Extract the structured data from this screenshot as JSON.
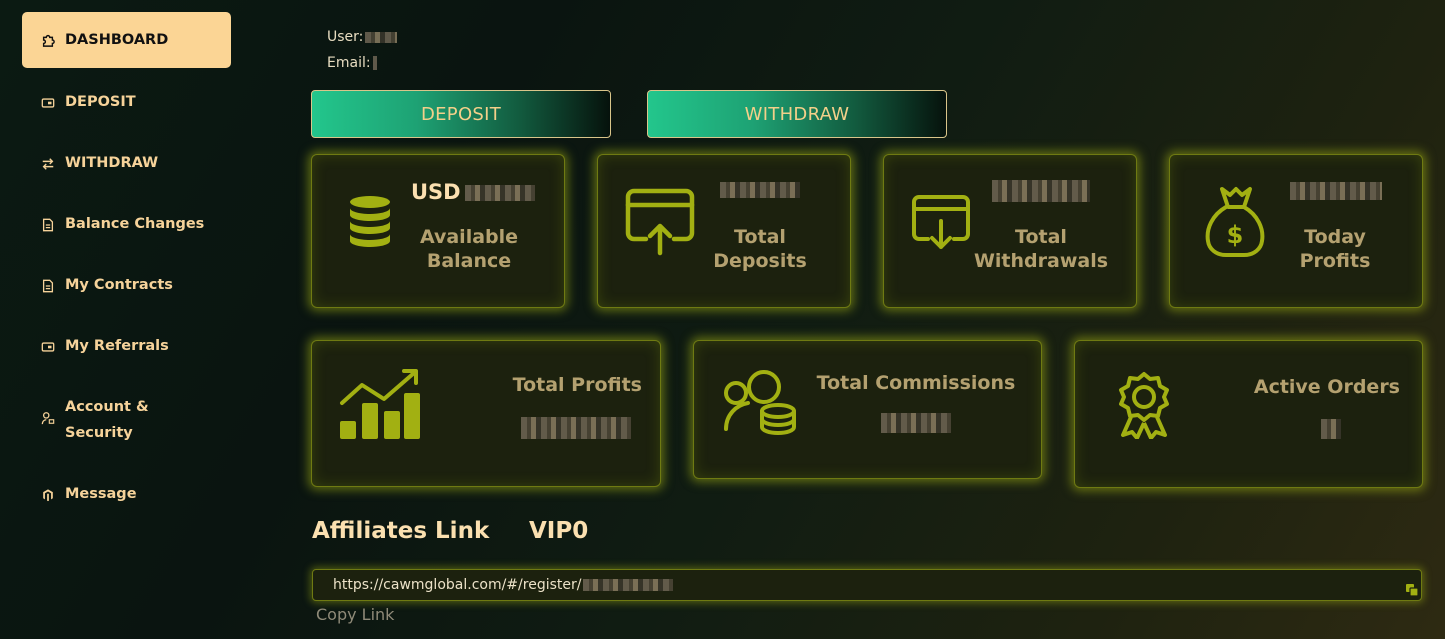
{
  "sidebar": {
    "items": [
      {
        "label": "DASHBOARD",
        "icon": "puzzle-icon"
      },
      {
        "label": "DEPOSIT",
        "icon": "wallet-icon"
      },
      {
        "label": "WITHDRAW",
        "icon": "transfer-icon"
      },
      {
        "label": "Balance Changes",
        "icon": "document-icon"
      },
      {
        "label": "My Contracts",
        "icon": "document-icon"
      },
      {
        "label": "My Referrals",
        "icon": "wallet-icon"
      },
      {
        "label": "Account &",
        "label2": "Security",
        "icon": "user-lock-icon"
      },
      {
        "label": "Message",
        "icon": "magento-icon"
      }
    ]
  },
  "user": {
    "user_label": "User:",
    "email_label": "Email:"
  },
  "actions": {
    "deposit": "DEPOSIT",
    "withdraw": "WITHDRAW"
  },
  "cards": {
    "balance": {
      "currency": "USD",
      "title1": "Available",
      "title2": "Balance"
    },
    "deposits": {
      "title1": "Total",
      "title2": "Deposits"
    },
    "withdrawals": {
      "title1": "Total",
      "title2": "Withdrawals"
    },
    "today": {
      "title1": "Today",
      "title2": "Profits"
    },
    "profits": {
      "title": "Total Profits"
    },
    "commissions": {
      "title": "Total Commissions"
    },
    "orders": {
      "title": "Active Orders"
    }
  },
  "affiliates": {
    "title": "Affiliates Link",
    "vip": "VIP0",
    "link": "https://cawmglobal.com/#/register/",
    "copy_label": "Copy Link"
  },
  "colors": {
    "accent": "#fbd595",
    "glow": "#a0af14",
    "icon": "#a2b012"
  }
}
